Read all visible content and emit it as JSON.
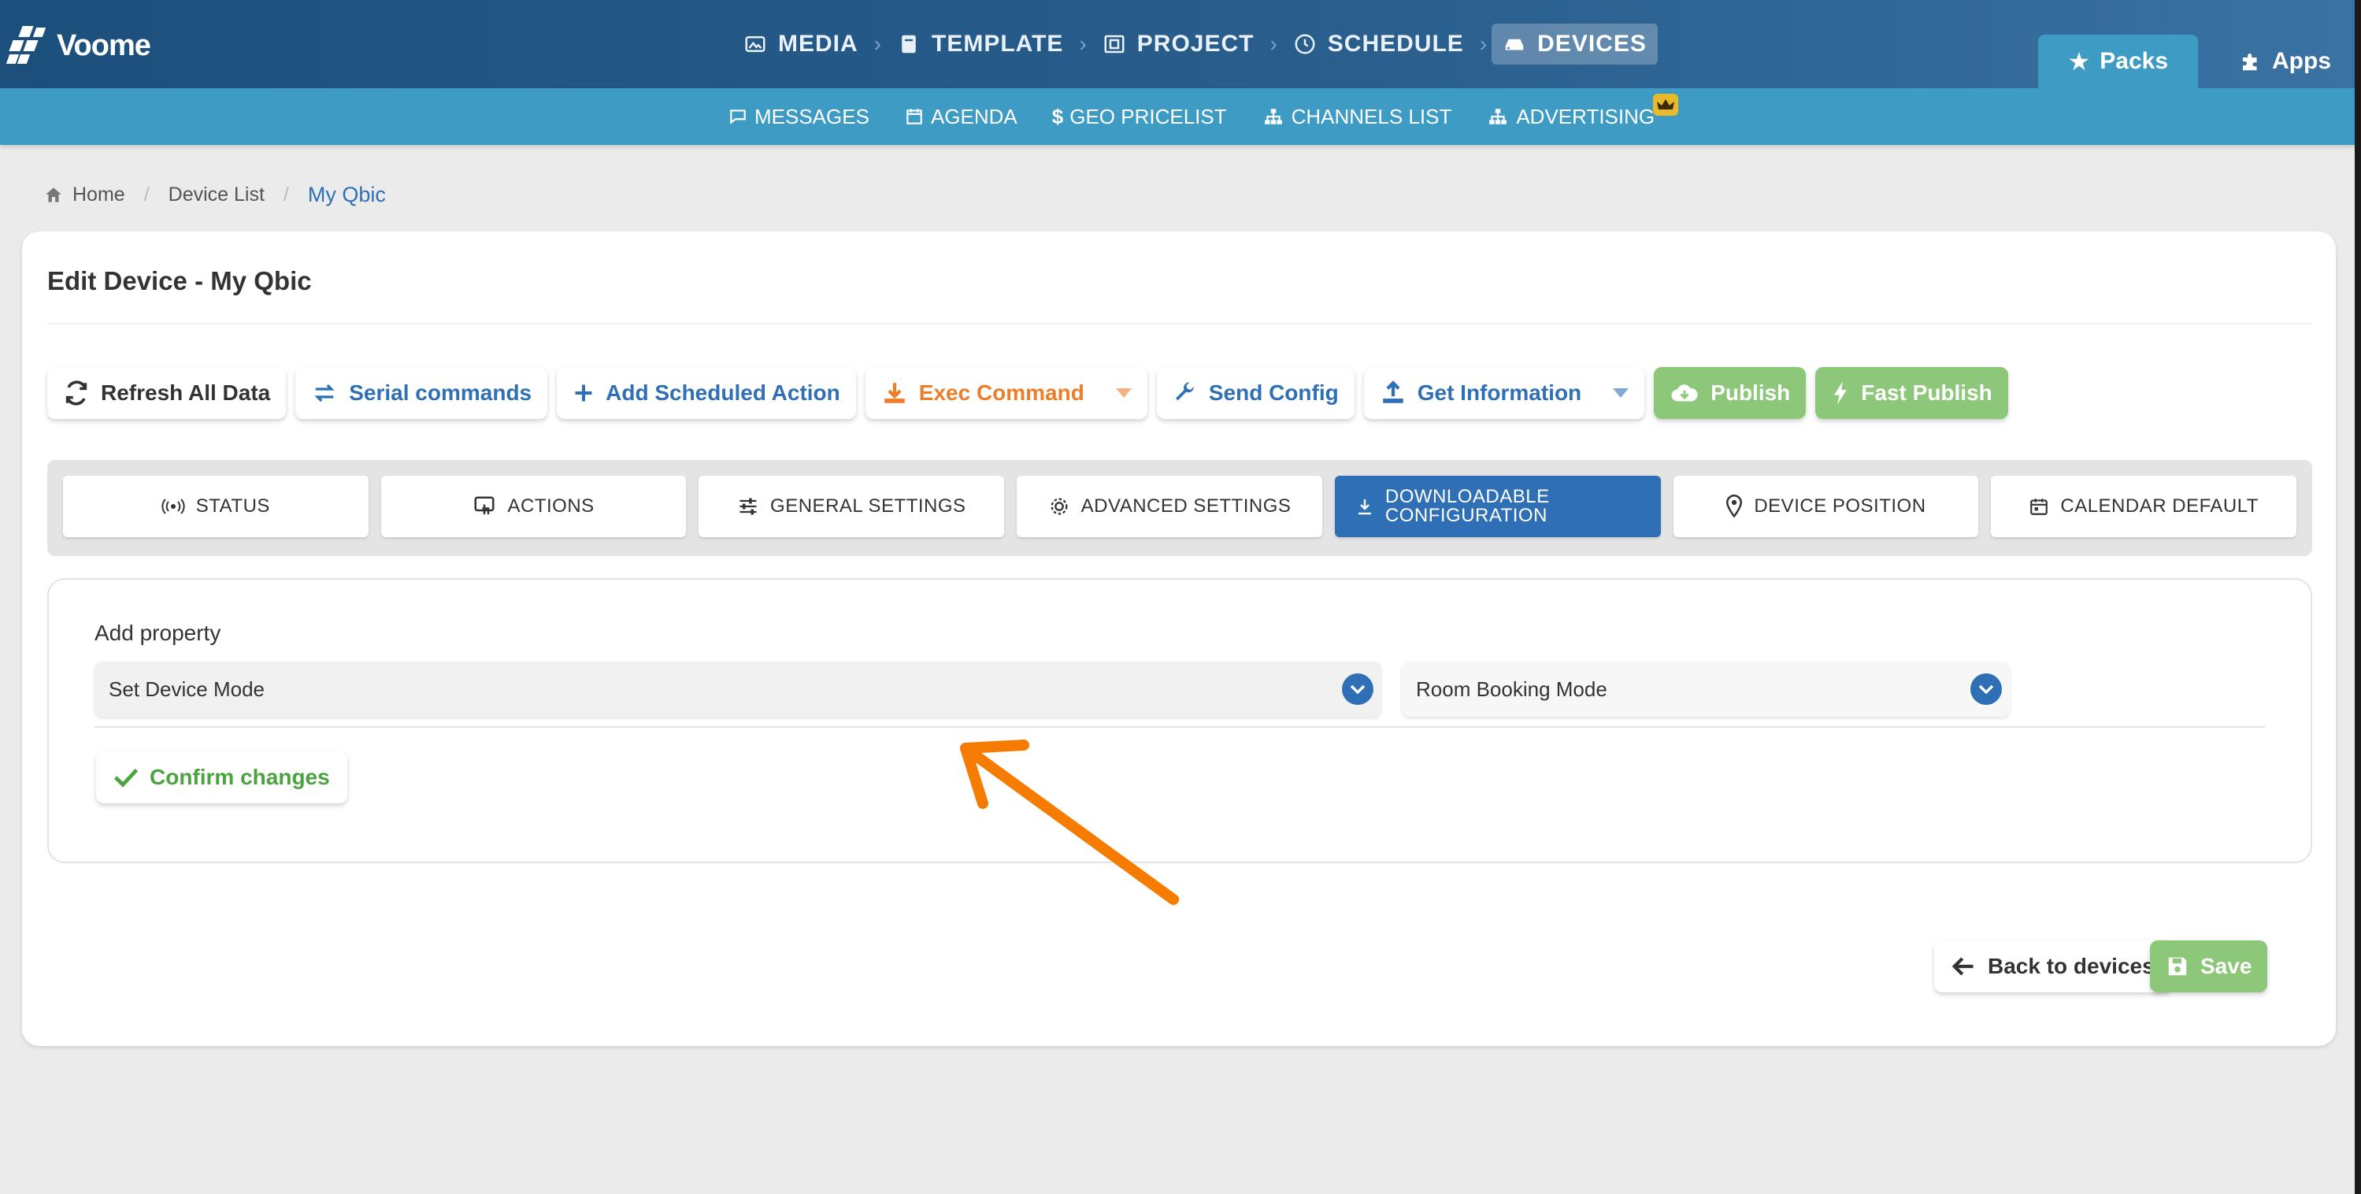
{
  "app": {
    "logo_text": "Voome"
  },
  "main_nav": [
    {
      "label": "MEDIA",
      "icon": "image-icon",
      "active": false
    },
    {
      "label": "TEMPLATE",
      "icon": "book-icon",
      "active": false
    },
    {
      "label": "PROJECT",
      "icon": "project-icon",
      "active": false
    },
    {
      "label": "SCHEDULE",
      "icon": "clock-icon",
      "active": false
    },
    {
      "label": "DEVICES",
      "icon": "device-icon",
      "active": true
    }
  ],
  "top_right": {
    "packs_label": "Packs",
    "apps_label": "Apps"
  },
  "sub_nav": [
    {
      "label": "MESSAGES",
      "icon": "chat-icon"
    },
    {
      "label": "AGENDA",
      "icon": "calendar-icon"
    },
    {
      "label": "GEO PRICELIST",
      "icon": "dollar-icon"
    },
    {
      "label": "CHANNELS LIST",
      "icon": "sitemap-icon"
    },
    {
      "label": "ADVERTISING",
      "icon": "sitemap-icon"
    }
  ],
  "breadcrumb": {
    "home": "Home",
    "list": "Device List",
    "current": "My Qbic"
  },
  "page": {
    "title": "Edit Device - My Qbic"
  },
  "actions": {
    "refresh": "Refresh All Data",
    "serial": "Serial commands",
    "add_scheduled": "Add Scheduled Action",
    "exec": "Exec Command",
    "send_config": "Send Config",
    "get_info": "Get Information",
    "publish": "Publish",
    "fast_publish": "Fast Publish"
  },
  "tabs": [
    {
      "label": "STATUS"
    },
    {
      "label": "ACTIONS"
    },
    {
      "label": "GENERAL SETTINGS"
    },
    {
      "label": "ADVANCED SETTINGS"
    },
    {
      "label_line1": "DOWNLOADABLE",
      "label_line2": "CONFIGURATION",
      "active": true
    },
    {
      "label": "DEVICE POSITION"
    },
    {
      "label": "CALENDAR DEFAULT"
    }
  ],
  "panel": {
    "label": "Add property",
    "property_select": "Set Device Mode",
    "value_select": "Room Booking Mode",
    "confirm": "Confirm changes"
  },
  "footer": {
    "back": "Back to devices",
    "save": "Save"
  },
  "colors": {
    "primary": "#2f6fb5",
    "nav_dark": "#1c4f7c",
    "subnav": "#3e9cc4",
    "green": "#8dc87a",
    "orange": "#ee7d2a",
    "arrow": "#f57c00"
  }
}
